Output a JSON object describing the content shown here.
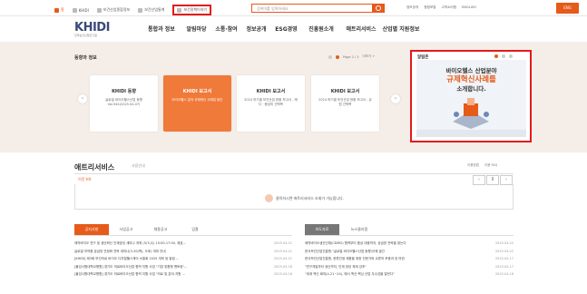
{
  "topbar": {
    "links": [
      {
        "label": "홈",
        "icon": "home-icon"
      },
      {
        "label": "KHIDI",
        "icon": "building-icon"
      },
      {
        "label": "보건산업종합정보",
        "icon": "info-icon"
      },
      {
        "label": "보건산업통계",
        "icon": "chart-icon"
      },
      {
        "label": "보건정책이야기",
        "icon": "book-icon"
      }
    ],
    "search_placeholder": "검색어를 입력하세요",
    "util_links": [
      "정보공개",
      "청렴포털",
      "고객소리함",
      "ENGLISH"
    ],
    "lang_label": "ENG",
    "accent": "#e65a1a",
    "highlight": "#e31b1b"
  },
  "header": {
    "logo_text": "KHIDI",
    "logo_sub": "한국보건산업진흥원",
    "menu": [
      "통합과 정보",
      "알림마당",
      "소통·참여",
      "정보공개",
      "ESG경영",
      "진흥원소개",
      "애트리서비스",
      "산업별 지원정보"
    ]
  },
  "promo": {
    "title": "동향과 정보",
    "pager_text": "Page 2 / 3",
    "more_label": "더보기 +",
    "cards": [
      {
        "logo": "KHIDI 동향",
        "text": "글로벌 바이오헬스산업 동향 Vol.544(2025.04.07)"
      },
      {
        "logo": "KHIDI 보고서",
        "text": "바이오헬스 분야 규제혁신 사례집 발간"
      },
      {
        "logo": "KHIDI 보고서",
        "text": "2024 하기별 보건산업 현황 보고서 - 메디 · 중남미 선택목"
      },
      {
        "logo": "KHIDI 보고서",
        "text": "2024 하기별 보건산업 현황 보고서 - 유럽 선택목"
      }
    ],
    "prev_icon": "chevron-left-icon",
    "next_icon": "chevron-right-icon"
  },
  "banner": {
    "title": "알림존",
    "line1": "바이오헬스 산업분야",
    "line2": "규제혁신사례를",
    "line3": "소개합니다.",
    "pager_text": "1/5"
  },
  "service": {
    "title": "애트리서비스",
    "subtitle": "서비스",
    "label": "사용안내",
    "links": [
      "이용방법",
      "이용 FAQ"
    ],
    "strip_label": "이전 Hit",
    "notice": "클릭하시면 애트리서비스 조회가 가능합니다.",
    "notice_highlight": "애트리서비스"
  },
  "board_left": {
    "tabs": [
      "공지사항",
      "사업공고",
      "채용공고",
      "입찰"
    ],
    "rows": [
      {
        "title": "제약바이오 연구 및 생산혁신 인재양성 세미나 개최 (5/7(수) 15:00-17:00, 제효...",
        "date": "2025.04.21"
      },
      {
        "title": "글로벌 의약품 공급망 안정화 전략 세미나(3.20(목), 오후) 개최 안내",
        "date": "2025.04.21"
      },
      {
        "title": "[KHIDI] 제3회 보건의료 바이오 디지털헬스케어 소통회 2025 개최 등 알림 ...",
        "date": "2025.04.21"
      },
      {
        "title": "[붙임사원대학교병원] 경기도 의료바이오산업 협력 지원 사업 \"기업 맞춤형 멘토링\"...",
        "date": "2025.04.18"
      },
      {
        "title": "[붙임사원대학교병원] 경기도 의료바이오산업 협력 지원 사업 \"의료 및 분야 지원 ...",
        "date": "2025.04.18"
      }
    ]
  },
  "board_right": {
    "tabs": [
      "보도자료",
      "뉴스클리핑"
    ],
    "rows": [
      {
        "title": "제약바이오생산인재(CDMO) 협력부터 품상 대중까지, 공급망 전략을 찾는다",
        "date": "2025.04.22"
      },
      {
        "title": "한국보건산업진흥원-\"글로벌 바이오헬스산업 동향/규제 발간",
        "date": "2025.04.22"
      },
      {
        "title": "한국보건산업진흥원, 한류인생 제품을 위한 전문가와 교류의 포용과 장 마련",
        "date": "2025.04.17"
      },
      {
        "title": "\"연구개발부터 생산까지, 인재 양성 체계 강조\"",
        "date": "2025.04.17"
      },
      {
        "title": "\"세계 백신 회의(4.21~24), 에서 백신 핵심 산업 우수성을 알린다\"",
        "date": "2025.04.16"
      }
    ]
  }
}
